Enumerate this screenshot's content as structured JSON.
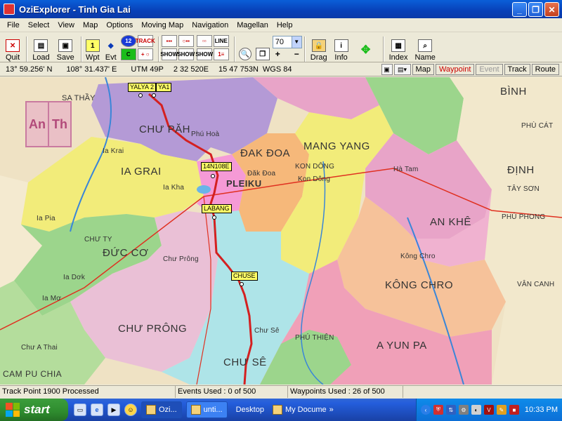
{
  "window": {
    "title": "OziExplorer - Tinh Gia Lai",
    "minimize": "_",
    "maximize": "❐",
    "close": "✕"
  },
  "menu": [
    "File",
    "Select",
    "View",
    "Map",
    "Options",
    "Moving Map",
    "Navigation",
    "Magellan",
    "Help"
  ],
  "toolbar": {
    "quit": "Quit",
    "load": "Load",
    "save": "Save",
    "wpt": "Wpt",
    "evt": "Evt",
    "track_label": "TRACK",
    "show": "SHOW",
    "zoom_value": "70",
    "drag": "Drag",
    "info": "Info",
    "index": "Index",
    "name": "Name"
  },
  "coords": {
    "lat": "13° 59.256' N",
    "lon": "108° 31.437' E",
    "utm": "UTM  49P",
    "easting": "2 32 520E",
    "northing": "15 47 753N",
    "datum": "WGS 84"
  },
  "modes": {
    "map": "Map",
    "waypoint": "Waypoint",
    "event": "Event",
    "track": "Track",
    "route": "Route"
  },
  "map": {
    "overview_cells": [
      "An",
      "Th"
    ],
    "districts": [
      "CHƯ PĂH",
      "IA GRAI",
      "PLEIKU",
      "ĐAK ĐOA",
      "MANG YANG",
      "KON DÔNG",
      "AN KHÊ",
      "ĐỨC CƠ",
      "CHƯ PRÔNG",
      "CHƯ SÊ",
      "KÔNG CHRO",
      "A YUN PA",
      "CHƯ TY",
      "PHÚ THIỆN"
    ],
    "neighbors": [
      "SA THẦY",
      "BÌNH",
      "PHÙ CÁT",
      "ĐỊNH",
      "TÂY SƠN",
      "PHÚ PHONG",
      "VÂN CANH",
      "CAM PU CHIA"
    ],
    "towns": [
      "Ia Krai",
      "Ia Kha",
      "Phú Hoà",
      "Đăk Đoa",
      "Kon Dông",
      "Ia Pia",
      "Ia Dơk",
      "Chư Prông",
      "Chư Sê",
      "Kông Chro",
      "Ia Mơ",
      "Hà Tam",
      "Chư A Thai"
    ],
    "waypoints": [
      "YALYA 2",
      "YA1",
      "14N108E",
      "LABANG",
      "CHUSE"
    ]
  },
  "status": {
    "track": "Track Point 1900 Processed",
    "events": "Events Used : 0 of 500",
    "waypoints": "Waypoints Used : 26 of 500"
  },
  "taskbar": {
    "start": "start",
    "tasks": [
      "Ozi...",
      "unti..."
    ],
    "desktop": "Desktop",
    "mydocs": "My Docume",
    "clock": "10:33 PM"
  },
  "colors": {
    "title_blue": "#0a5fd8",
    "start_green": "#2e8b2e",
    "track_red": "#d42020",
    "waypoint_yellow": "#ffff66"
  }
}
